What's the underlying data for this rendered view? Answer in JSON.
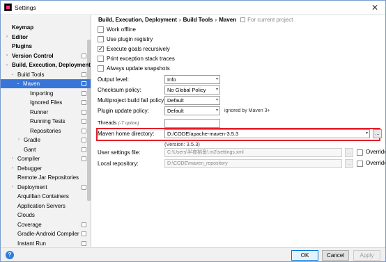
{
  "window": {
    "title": "Settings",
    "close_glyph": "✕"
  },
  "sidebar": {
    "items": [
      {
        "label": "Keymap",
        "bold": true
      },
      {
        "label": "Editor",
        "bold": true,
        "arrow": ">"
      },
      {
        "label": "Plugins",
        "bold": true
      },
      {
        "label": "Version Control",
        "bold": true,
        "arrow": ">"
      },
      {
        "label": "Build, Execution, Deployment",
        "bold": true,
        "arrow": "v"
      },
      {
        "label": "Build Tools",
        "arrow": "v"
      },
      {
        "label": "Maven",
        "arrow": "v"
      },
      {
        "label": "Importing"
      },
      {
        "label": "Ignored Files"
      },
      {
        "label": "Runner"
      },
      {
        "label": "Running Tests"
      },
      {
        "label": "Repositories"
      },
      {
        "label": "Gradle",
        "arrow": ">"
      },
      {
        "label": "Gant"
      },
      {
        "label": "Compiler",
        "arrow": ">"
      },
      {
        "label": "Debugger",
        "arrow": ">"
      },
      {
        "label": "Remote Jar Repositories"
      },
      {
        "label": "Deployment",
        "arrow": ">"
      },
      {
        "label": "Arquillian Containers"
      },
      {
        "label": "Application Servers"
      },
      {
        "label": "Clouds"
      },
      {
        "label": "Coverage"
      },
      {
        "label": "Gradle-Android Compiler"
      },
      {
        "label": "Instant Run"
      }
    ]
  },
  "breadcrumb": {
    "part1": "Build, Execution, Deployment",
    "part2": "Build Tools",
    "part3": "Maven",
    "separator": "›",
    "scope": "For current project"
  },
  "checkboxes": {
    "work_offline": {
      "label": "Work offline",
      "checked": false
    },
    "use_plugin_registry": {
      "label": "Use plugin registry",
      "checked": false
    },
    "execute_goals_recursively": {
      "label": "Execute goals recursively",
      "checked": true
    },
    "print_exception_stack_traces": {
      "label": "Print exception stack traces",
      "checked": false
    },
    "always_update_snapshots": {
      "label": "Always update snapshots",
      "checked": false
    }
  },
  "check_glyph": "✓",
  "fields": {
    "output_level": {
      "label": "Output level:",
      "value": "Info"
    },
    "checksum_policy": {
      "label": "Checksum policy:",
      "value": "No Global Policy"
    },
    "multiproject_fail_policy": {
      "label": "Multiproject build fail policy:",
      "value": "Default"
    },
    "plugin_update_policy": {
      "label": "Plugin update policy:",
      "value": "Default",
      "note": "ignored by Maven 3+"
    },
    "threads": {
      "label": "Threads",
      "hint": "(-T option)",
      "value": ""
    },
    "maven_home": {
      "label": "Maven home directory:",
      "value": "D:/CODE/apache-maven-3.5.3",
      "version": "(Version: 3.5.3)"
    },
    "user_settings": {
      "label": "User settings file:",
      "value": "C:\\Users\\半夜桃鱼\\.m2\\settings.xml"
    },
    "local_repository": {
      "label": "Local repository:",
      "value": "D:\\CODE\\maven_repository"
    }
  },
  "override": {
    "label": "Override"
  },
  "dropdown_glyph": "▾",
  "browse_glyph": "...",
  "footer": {
    "help_glyph": "?",
    "ok": "OK",
    "cancel": "Cancel",
    "apply": "Apply"
  },
  "colors": {
    "selection": "#3875d7",
    "highlight_border": "#e3202b",
    "help": "#2f7ed8"
  }
}
